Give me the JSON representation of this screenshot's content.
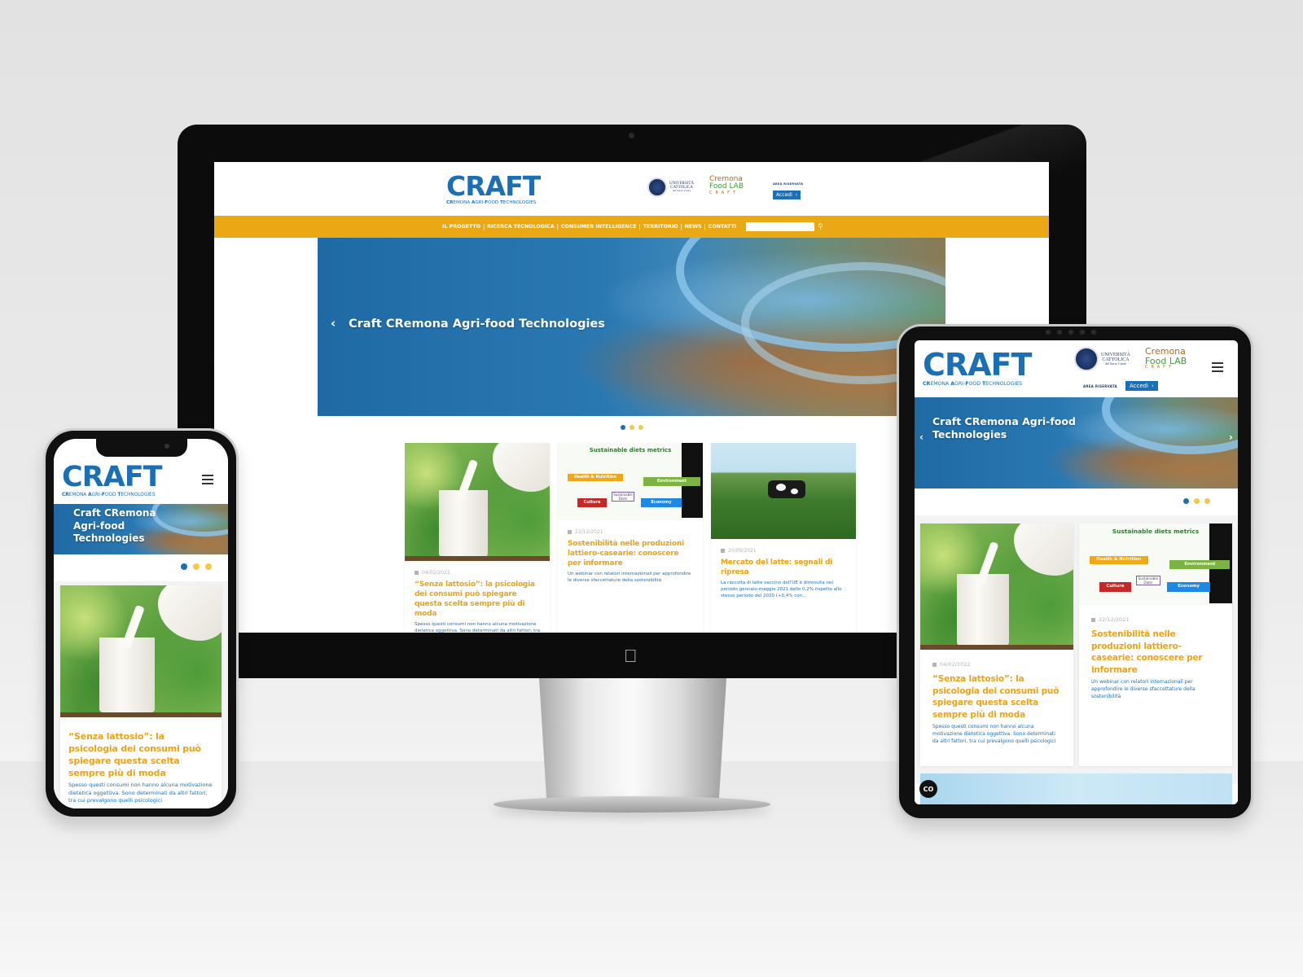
{
  "site": {
    "logo_title": "CRAFT",
    "logo_subtitle_parts": [
      {
        "bold": "CR",
        "rest": "EMONA "
      },
      {
        "bold": "A",
        "rest": "GRI-"
      },
      {
        "bold": "F",
        "rest": "OOD "
      },
      {
        "bold": "T",
        "rest": "ECHNOLOGIES"
      }
    ],
    "university": {
      "line1": "UNIVERSITÀ",
      "line2": "CATTOLICA",
      "line3": "del Sacro Cuore"
    },
    "foodlab": {
      "line1": "Cremona",
      "line2": "Food LAB",
      "line3": "CRAFT"
    },
    "area_label": "AREA RISERVATA",
    "accedi_label": "Accedi",
    "accedi_icon": "chevron-right",
    "nav": [
      "IL PROGETTO",
      "RICERCA TECNOLOGICA",
      "CONSUMER INTELLIGENCE",
      "TERRITORIO",
      "NEWS",
      "CONTATTI"
    ],
    "nav_separator": "|",
    "search": {
      "value": "",
      "placeholder": "",
      "icon": "search-icon"
    },
    "hero": {
      "title": "Craft CRemona Agri-food Technologies",
      "prev_icon": "‹",
      "next_icon": "›",
      "slides_total": 3,
      "active_slide": 1
    },
    "cc_label": "CO",
    "colors": {
      "brand_blue": "#1b6fb5",
      "brand_yellow": "#e9a814",
      "title_orange": "#e8a317"
    },
    "articles": [
      {
        "date": "04/02/2022",
        "title": "“Senza lattosio”: la psicologia dei consumi può spiegare questa scelta sempre più di moda",
        "excerpt": "Spesso questi consumi non hanno alcuna motivazione dietetica oggettiva. Sono determinati da altri fattori, tra cui prevalgono quelli psicologici",
        "thumb": "milk"
      },
      {
        "date": "22/12/2021",
        "title": "Sostenibilità nelle produzioni lattiero-casearie: conoscere per informare",
        "excerpt": "Un webinar con relatori internazionali per approfondire le diverse sfaccettature della sostenibilità",
        "thumb": "slide",
        "slide": {
          "title": "Sustainable diets metrics",
          "boxes": [
            "Health & Nutrition",
            "Environment",
            "Culture",
            "Economy"
          ],
          "center": "Sustainable Diets"
        }
      },
      {
        "date": "20/09/2021",
        "title": "Mercato del latte: segnali di ripresa",
        "excerpt": "La raccolta di latte vaccino dell'UE è diminuita nel periodo gennaio-maggio 2021 dello 0,2% rispetto allo stesso periodo del 2020 (+0,4% con...",
        "thumb": "cow"
      }
    ]
  }
}
